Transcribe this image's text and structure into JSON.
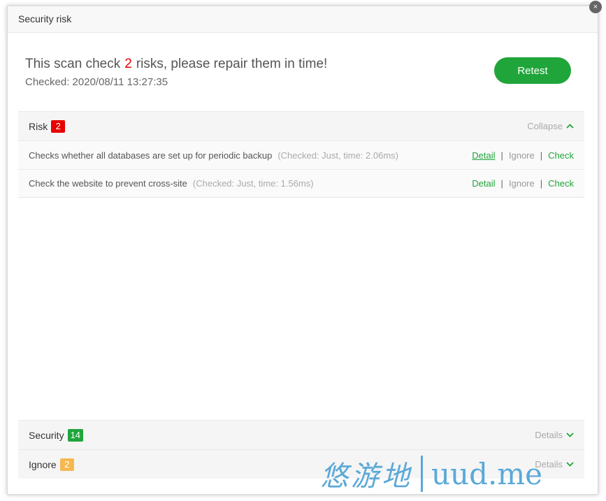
{
  "dialog": {
    "title": "Security risk",
    "close_glyph": "×"
  },
  "summary": {
    "headline_prefix": "This scan check",
    "risk_count": "2",
    "headline_suffix": "risks, please repair them in time!",
    "checked_label": "Checked:",
    "checked_time": "2020/08/11 13:27:35"
  },
  "retest_label": "Retest",
  "risk_panel": {
    "label": "Risk",
    "count": "2",
    "toggle_label": "Collapse",
    "toggle_icon": "chevron-up-icon",
    "items": [
      {
        "text": "Checks whether all databases are set up for periodic backup",
        "meta": "(Checked: Just, time: 2.06ms)",
        "detail": "Detail",
        "ignore": "Ignore",
        "check": "Check"
      },
      {
        "text": "Check the website to prevent cross-site",
        "meta": "(Checked: Just, time: 1.56ms)",
        "detail": "Detail",
        "ignore": "Ignore",
        "check": "Check"
      }
    ],
    "separator": "|"
  },
  "security_panel": {
    "label": "Security",
    "count": "14",
    "toggle_label": "Details",
    "toggle_icon": "chevron-down-icon"
  },
  "ignore_panel": {
    "label": "Ignore",
    "count": "2",
    "toggle_label": "Details",
    "toggle_icon": "chevron-down-icon"
  },
  "watermark": {
    "cn": "悠游地",
    "en": "uud.me"
  },
  "colors": {
    "accent_green": "#20a53a",
    "risk_red": "#e60000",
    "ignore_orange": "#f7b851"
  }
}
